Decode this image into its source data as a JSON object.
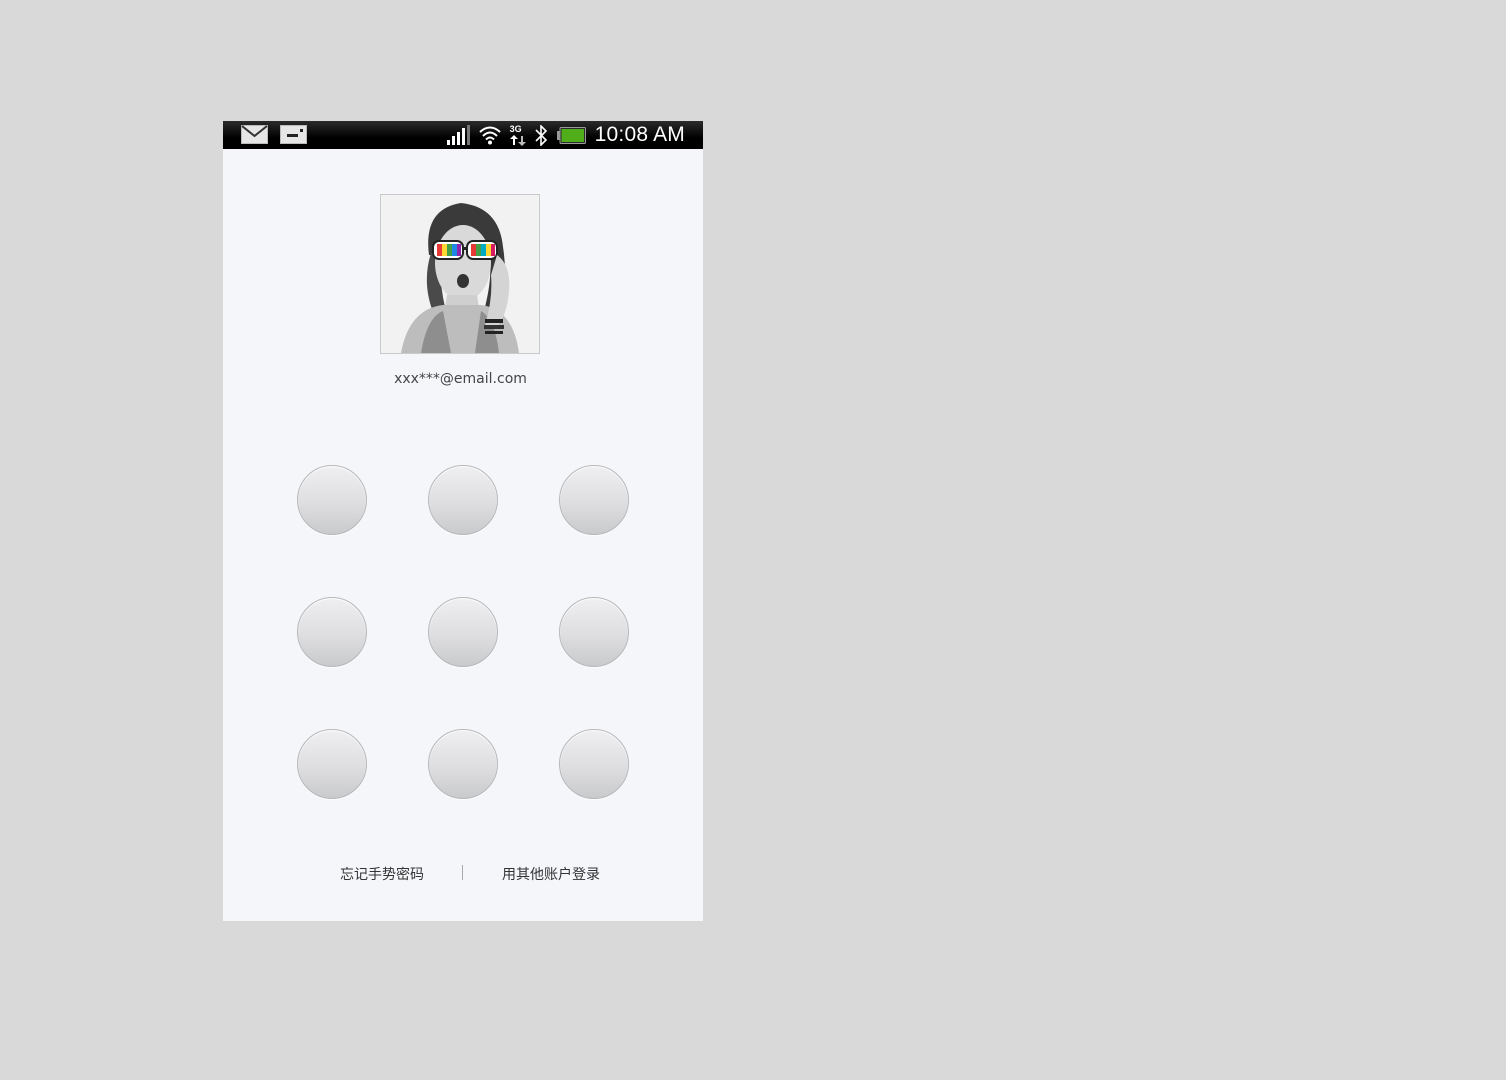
{
  "status_bar": {
    "time": "10:08 AM",
    "icons": [
      "mail-icon",
      "sim-card-icon",
      "signal-icon",
      "wifi-icon",
      "3g-data-icon",
      "bluetooth-icon",
      "battery-icon"
    ],
    "network_label": "3G",
    "battery_color": "#4fae1a"
  },
  "account": {
    "email": "xxx***@email.com"
  },
  "pattern_lock": {
    "rows": 3,
    "cols": 3,
    "dot_color": "#d8d9db"
  },
  "footer": {
    "forgot_label": "忘记手势密码",
    "other_account_label": "用其他账户登录"
  }
}
